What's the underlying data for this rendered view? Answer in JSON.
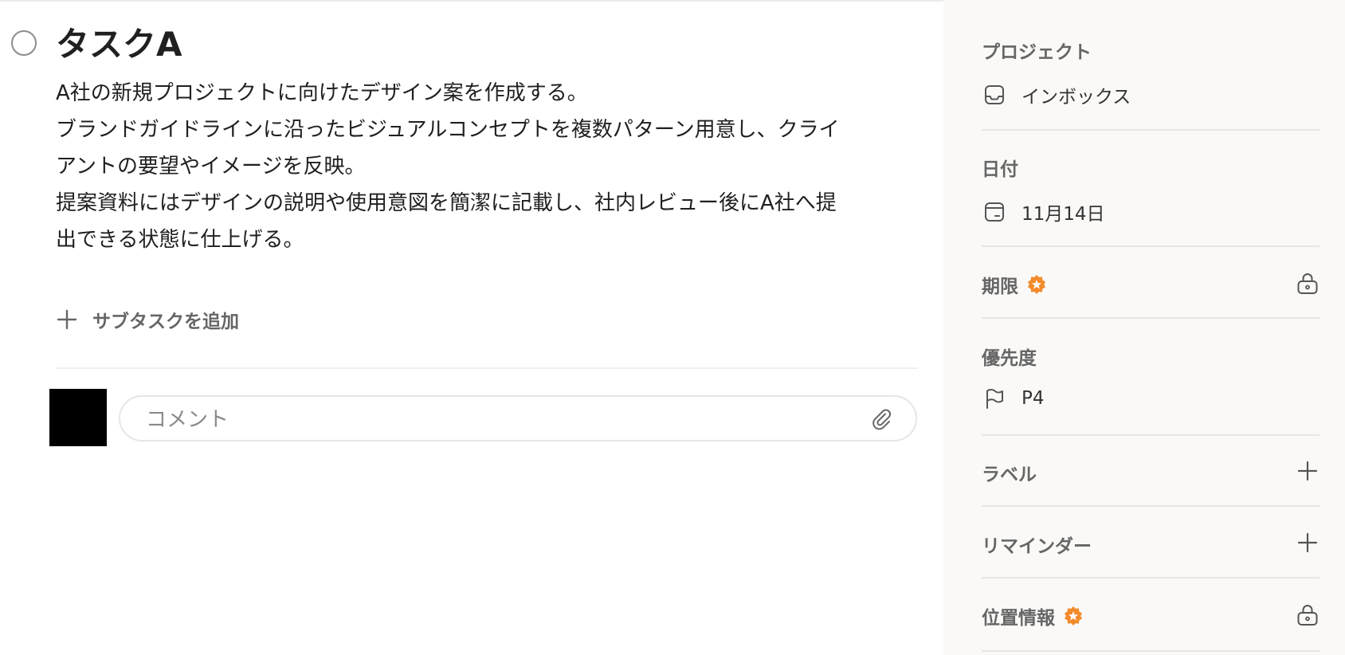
{
  "task": {
    "title": "タスクA",
    "description": [
      "A社の新規プロジェクトに向けたデザイン案を作成する。",
      "ブランドガイドラインに沿ったビジュアルコンセプトを複数パターン用意し、クライ",
      "アントの要望やイメージを反映。",
      "提案資料にはデザインの説明や使用意図を簡潔に記載し、社内レビュー後にA社へ提",
      "出できる状態に仕上げる。"
    ],
    "add_subtask_label": "サブタスクを追加",
    "comment_placeholder": "コメント"
  },
  "sidebar": {
    "project": {
      "label": "プロジェクト",
      "value": "インボックス",
      "icon": "inbox-icon"
    },
    "date": {
      "label": "日付",
      "value": "11月14日",
      "icon": "calendar-icon"
    },
    "deadline": {
      "label": "期限",
      "badge": "premium-badge-icon",
      "action_icon": "lock-icon"
    },
    "priority": {
      "label": "優先度",
      "value": "P4",
      "icon": "flag-icon"
    },
    "labels": {
      "label": "ラベル",
      "action_icon": "plus-icon"
    },
    "reminders": {
      "label": "リマインダー",
      "action_icon": "plus-icon"
    },
    "location": {
      "label": "位置情報",
      "badge": "premium-badge-icon",
      "action_icon": "lock-icon"
    }
  },
  "colors": {
    "sidebar_bg": "#faf9f7",
    "premium_badge": "#f38b2b",
    "muted_text": "#666666",
    "avatar": "#000000"
  }
}
